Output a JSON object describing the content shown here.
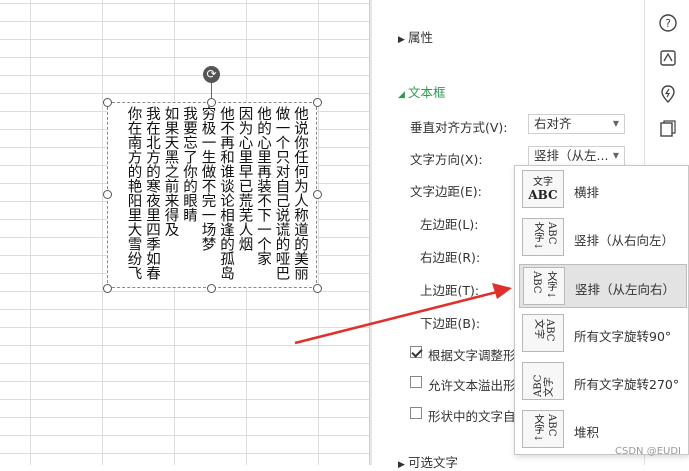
{
  "textbox": {
    "lines": [
      "他说你任何为人称道的美丽",
      "做一个只对自己说谎的哑巴",
      "他的心里再装不下一个家",
      "因为心里早已荒芜人烟",
      "他不再和谁谈论相逢的孤岛",
      "穷极一生做不完一场梦",
      "我要忘了你的眼睛",
      "如果天黑之前来得及",
      "我在北方的寒夜里四季如春",
      "你在南方的艳阳里大雪纷飞"
    ],
    "rotate_icon": "rotate-icon"
  },
  "panel": {
    "section_properties": "属性",
    "section_textbox": "文本框",
    "section_alt_text": "可选文字",
    "vertical_align_label": "垂直对齐方式(V):",
    "vertical_align_value": "右对齐",
    "text_direction_label": "文字方向(X):",
    "text_direction_value": "竖排（从左...",
    "text_margin_label": "文字边距(E):",
    "left_margin_label": "左边距(L):",
    "right_margin_label": "右边距(R):",
    "top_margin_label": "上边距(T):",
    "bottom_margin_label": "下边距(B):",
    "check_resize_label": "根据文字调整形状",
    "check_resize_checked": true,
    "check_overflow_label": "允许文本溢出形状",
    "check_overflow_checked": false,
    "check_wrap_label": "形状中的文字自动换行",
    "check_wrap_checked": false
  },
  "icon_strip": [
    "help-icon",
    "styles-icon",
    "location-icon",
    "book-icon"
  ],
  "dropdown": {
    "items": [
      {
        "label": "横排",
        "icon": "text-horizontal-icon",
        "selected": false
      },
      {
        "label": "竖排（从右向左）",
        "icon": "text-vertical-rtl-icon",
        "selected": false
      },
      {
        "label": "竖排（从左向右）",
        "icon": "text-vertical-ltr-icon",
        "selected": true
      },
      {
        "label": "所有文字旋转90°",
        "icon": "text-rotate-90-icon",
        "selected": false
      },
      {
        "label": "所有文字旋转270°",
        "icon": "text-rotate-270-icon",
        "selected": false
      },
      {
        "label": "堆积",
        "icon": "text-stacked-icon",
        "selected": false
      }
    ]
  },
  "watermark": "CSDN @EUDI",
  "colors": {
    "accent_green": "#2e9b4f",
    "arrow_red": "#e0302c"
  }
}
